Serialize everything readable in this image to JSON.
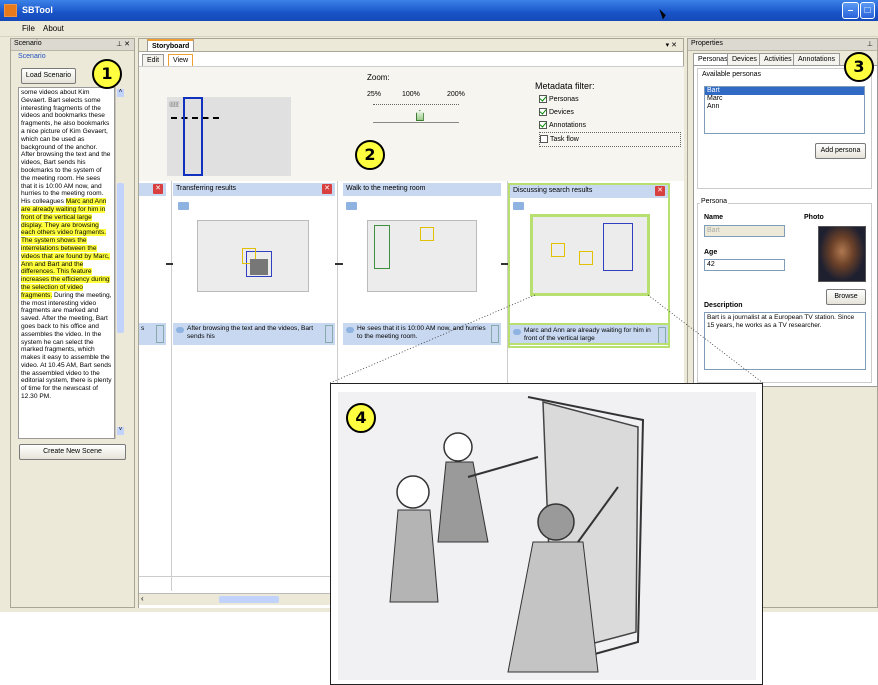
{
  "window": {
    "title": "SBTool"
  },
  "menu": {
    "items": [
      "File",
      "About"
    ]
  },
  "scenario": {
    "panel_title": "Scenario",
    "group_label": "Scenario",
    "load_button": "Load Scenario",
    "text_segments": [
      {
        "t": "some videos about Kim Gevaert. Bart selects some interesting fragments of the videos and bookmarks these fragments, he also bookmarks a nice picture of Kim Gevaert, which can be used as background of the anchor. After browsing the text and the videos, Bart sends his bookmarks to the system of the meeting room. He sees that it is 10:00 AM now, and hurries to the meeting room. His colleagues ",
        "hl": false
      },
      {
        "t": "Marc and Ann are already waiting for him in front of the vertical large display. They are browsing each others video fragments. The system shows the interrelations between the videos that are found by Marc, Ann and Bart and the differences. This feature increases the efficiency during the selection of video fragments.",
        "hl": true
      },
      {
        "t": " During the meeting, the most interesting video fragments are marked and saved. After the meeting, Bart goes back to his office and assembles the video. In the system he can select the marked fragments, which makes it easy to assemble the video. At 10.45 AM, Bart sends the assembled video to the editorial system, there is plenty of time for the newscast of 12.30 PM.",
        "hl": false
      }
    ],
    "create_button": "Create New Scene"
  },
  "storyboard": {
    "doc_tab": "Storyboard",
    "tabs": [
      "Edit",
      "View"
    ],
    "active_tab": "View",
    "zoom": {
      "label": "Zoom:",
      "ticks": [
        "25%",
        "100%",
        "200%"
      ],
      "value_percent": 100
    },
    "metadata": {
      "title": "Metadata filter:",
      "items": [
        {
          "label": "Personas",
          "checked": true
        },
        {
          "label": "Devices",
          "checked": true
        },
        {
          "label": "Annotations",
          "checked": true
        },
        {
          "label": "Task flow",
          "checked": false
        }
      ]
    },
    "scenes": [
      {
        "title": "",
        "note": ""
      },
      {
        "title": "Transferring results",
        "note": "After browsing the text and the videos, Bart sends his"
      },
      {
        "title": "Walk to the meeting room",
        "note": "He sees that it is 10:00 AM now, and hurries to the meeting room."
      },
      {
        "title": "Discussing search results",
        "note": "Marc and Ann are already waiting for him in front of the vertical large"
      }
    ],
    "note_partial": "s"
  },
  "properties": {
    "panel_title": "Properties",
    "tabs": [
      "Personas",
      "Devices",
      "Activities",
      "Annotations"
    ],
    "active_tab": "Personas",
    "available_label": "Available personas",
    "personas": [
      "Bart",
      "Marc",
      "Ann"
    ],
    "selected_persona": "Bart",
    "add_button": "Add persona",
    "group_label": "Persona",
    "name_label": "Name",
    "name_value": "Bart",
    "photo_label": "Photo",
    "age_label": "Age",
    "age_value": "42",
    "browse_button": "Browse",
    "description_label": "Description",
    "description_value": "Bart is a journalist at a European TV station. Since 15 years, he works as a TV researcher."
  },
  "callouts": [
    "1",
    "2",
    "3",
    "4"
  ],
  "colors": {
    "title_bar": "#1954c8",
    "highlight": "#ffff3c",
    "scene_header": "#c8d8f0",
    "selected_scene": "#b8e070",
    "badge": "#ffff40"
  }
}
